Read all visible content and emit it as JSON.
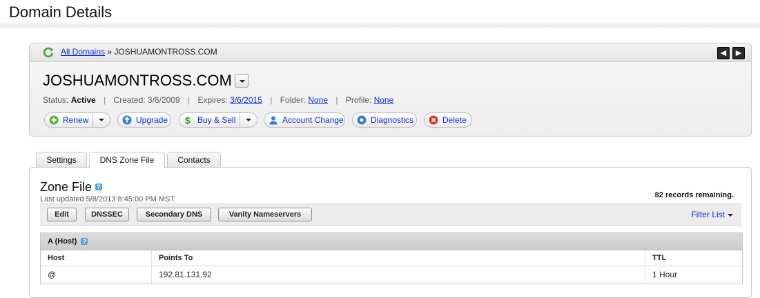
{
  "page": {
    "title": "Domain Details"
  },
  "breadcrumb": {
    "link": "All Domains",
    "separator": "»",
    "current": "JOSHUAMONTROSS.COM"
  },
  "domain": {
    "name": "JOSHUAMONTROSS.COM",
    "status_label": "Status:",
    "status_value": "Active",
    "created_label": "Created:",
    "created_value": "3/6/2009",
    "expires_label": "Expires:",
    "expires_value": "3/6/2015",
    "folder_label": "Folder:",
    "folder_value": "None",
    "profile_label": "Profile:",
    "profile_value": "None",
    "separator": "|"
  },
  "actions": {
    "renew": "Renew",
    "upgrade": "Upgrade",
    "buy_sell": "Buy & Sell",
    "account_change": "Account Change",
    "diagnostics": "Diagnostics",
    "delete": "Delete"
  },
  "tabs": [
    {
      "label": "Settings",
      "active": false
    },
    {
      "label": "DNS Zone File",
      "active": true
    },
    {
      "label": "Contacts",
      "active": false
    }
  ],
  "zone": {
    "title": "Zone File",
    "last_updated": "Last updated 5/8/2013 8:45:00 PM MST",
    "records_remaining": "82 records remaining.",
    "toolbar": {
      "edit": "Edit",
      "dnssec": "DNSSEC",
      "secondary_dns": "Secondary DNS",
      "vanity_nameservers": "Vanity Nameservers",
      "filter_list": "Filter List"
    },
    "section": "A (Host)",
    "columns": [
      "Host",
      "Points To",
      "TTL"
    ],
    "rows": [
      {
        "host": "@",
        "points_to": "192.81.131.92",
        "ttl": "1 Hour"
      }
    ]
  },
  "colors": {
    "link": "#0b2fd8",
    "help": "#5aa3d8",
    "renew_green": "#5cb335",
    "delete_red": "#d93a2b"
  }
}
